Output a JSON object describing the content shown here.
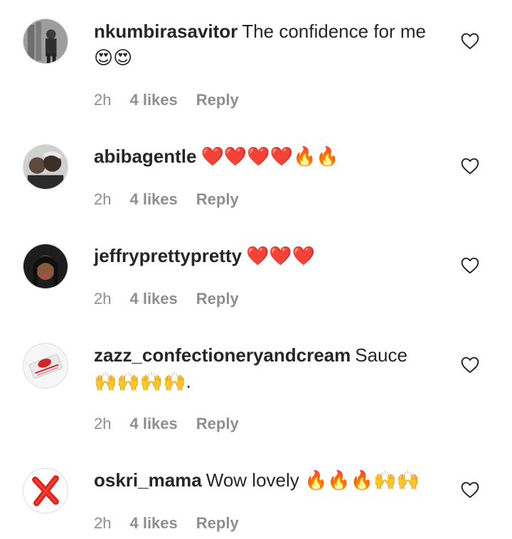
{
  "comments": [
    {
      "username": "nkumbirasavitor",
      "text": "The confidence for me 😍😍",
      "time": "2h",
      "likes": "4 likes",
      "reply": "Reply",
      "avatar": "grayscale-photo-man"
    },
    {
      "username": "abibagentle",
      "text": "❤️❤️❤️❤️🔥🔥",
      "time": "2h",
      "likes": "4 likes",
      "reply": "Reply",
      "avatar": "couple-photo"
    },
    {
      "username": "jeffryprettypretty",
      "text": "❤️❤️❤️",
      "time": "2h",
      "likes": "4 likes",
      "reply": "Reply",
      "avatar": "woman-selfie"
    },
    {
      "username": "zazz_confectioneryandcream",
      "text": "Sauce 🙌🙌🙌🙌.",
      "time": "2h",
      "likes": "4 likes",
      "reply": "Reply",
      "avatar": "bakery-logo"
    },
    {
      "username": "oskri_mama",
      "text": "Wow lovely 🔥🔥🔥🙌🙌",
      "time": "2h",
      "likes": "4 likes",
      "reply": "Reply",
      "avatar": "red-x-mark"
    }
  ],
  "colors": {
    "text": "#262626",
    "meta": "#8e8e8e",
    "heart_outline": "#262626",
    "red_x": "#e0241b"
  },
  "icons": {
    "like": "heart-outline-icon"
  }
}
